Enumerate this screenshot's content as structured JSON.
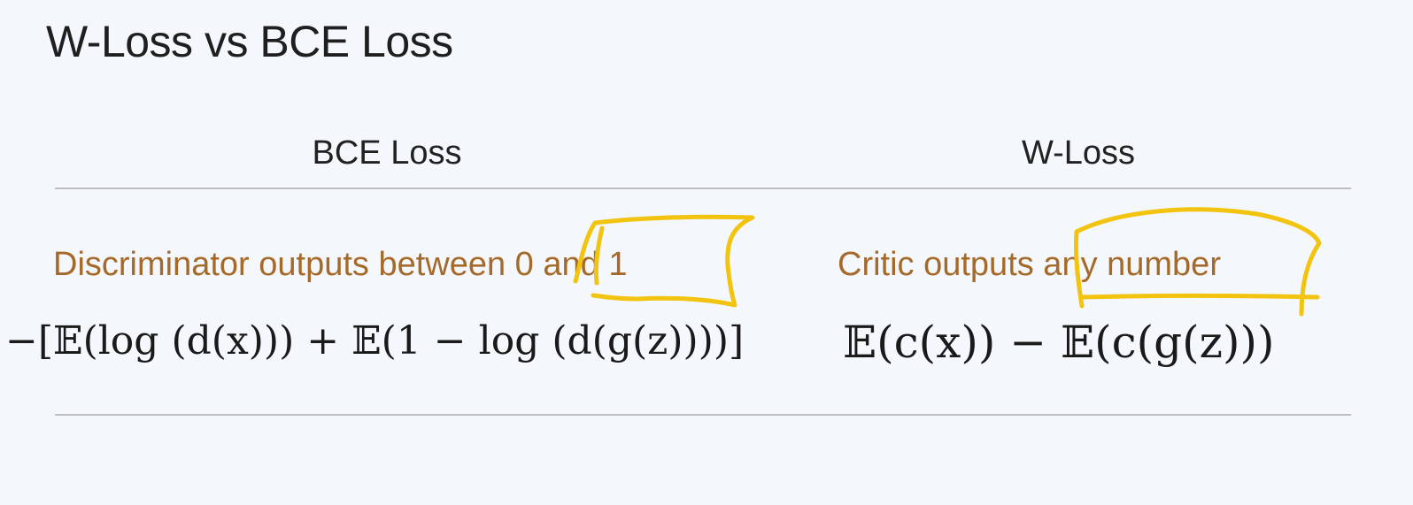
{
  "slide": {
    "title": "W-Loss vs BCE Loss",
    "columns": [
      {
        "header": "BCE Loss",
        "description": "Discriminator outputs between 0 and 1",
        "formula": "−[𝔼(log (d(x))) + 𝔼(1 − log (d(g(z))))]"
      },
      {
        "header": "W-Loss",
        "description": "Critic  outputs any number",
        "formula": "𝔼(c(x)) − 𝔼(c(g(z)))"
      }
    ]
  },
  "colors": {
    "text": "#1f1f1f",
    "description": "#a56a2a",
    "rule": "#bdbdbd",
    "highlight": "#f2c40f",
    "background": "#f4f7fb"
  }
}
